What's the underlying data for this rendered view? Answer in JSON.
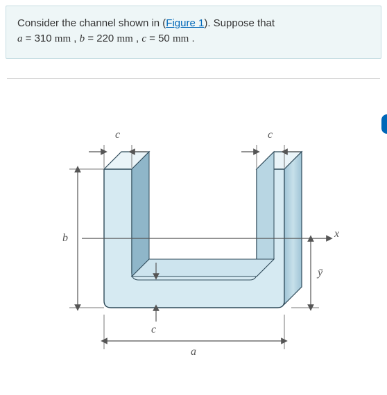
{
  "prompt": {
    "lead": "Consider the channel shown in (",
    "figure_link": "Figure 1",
    "after_link": "). Suppose that",
    "eq_a_var": "a",
    "eq_a_val": " = 310 ",
    "eq_a_unit": "mm",
    "sep1": " , ",
    "eq_b_var": "b",
    "eq_b_val": " = 220 ",
    "eq_b_unit": "mm",
    "sep2": " , ",
    "eq_c_var": "c",
    "eq_c_val": " = 50 ",
    "eq_c_unit": "mm",
    "period": " ."
  },
  "labels": {
    "c_top_left": "c",
    "c_top_right": "c",
    "c_bottom": "c",
    "a": "a",
    "b": "b",
    "x": "x",
    "ybar": "ȳ"
  },
  "figure": {
    "type": "engineering-drawing",
    "description": "U-shaped channel cross-section",
    "dimensions": {
      "a_mm": 310,
      "b_mm": 220,
      "c_mm": 50
    }
  }
}
